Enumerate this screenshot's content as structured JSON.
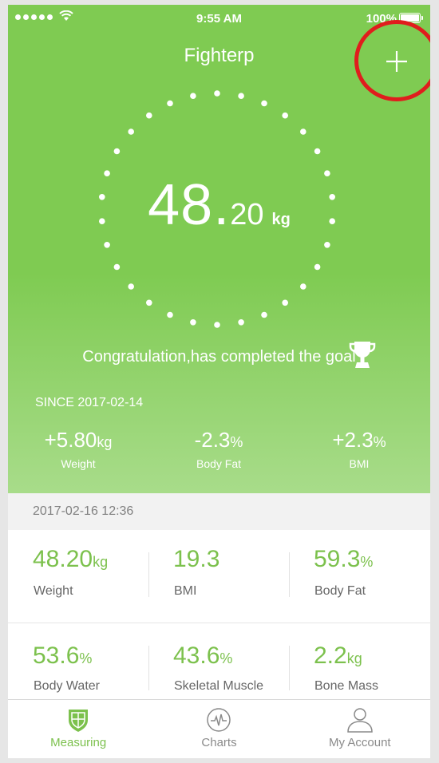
{
  "status_bar": {
    "time": "9:55 AM",
    "battery": "100%"
  },
  "header": {
    "title": "Fighterp"
  },
  "current": {
    "weight_int": "48.",
    "weight_dec": "20",
    "unit": "kg"
  },
  "goal_message": "Congratulation,has completed the goal",
  "since": {
    "label": "SINCE 2017-02-14",
    "changes": [
      {
        "value": "+5.80",
        "unit": "kg",
        "label": "Weight"
      },
      {
        "value": "-2.3",
        "unit": "%",
        "label": "Body Fat"
      },
      {
        "value": "+2.3",
        "unit": "%",
        "label": "BMI"
      }
    ]
  },
  "record": {
    "datetime": "2017-02-16  12:36",
    "metrics": [
      {
        "value": "48.20",
        "unit": "kg",
        "label": "Weight"
      },
      {
        "value": "19.3",
        "unit": "",
        "label": "BMI"
      },
      {
        "value": "59.3",
        "unit": "%",
        "label": "Body Fat"
      },
      {
        "value": "53.6",
        "unit": "%",
        "label": "Body Water"
      },
      {
        "value": "43.6",
        "unit": "%",
        "label": "Skeletal Muscle"
      },
      {
        "value": "2.2",
        "unit": "kg",
        "label": "Bone Mass"
      }
    ]
  },
  "tabs": [
    {
      "label": "Measuring",
      "icon": "shield-icon",
      "active": true
    },
    {
      "label": "Charts",
      "icon": "pulse-chart-icon",
      "active": false
    },
    {
      "label": "My Account",
      "icon": "user-icon",
      "active": false
    }
  ],
  "colors": {
    "accent": "#7cc14d",
    "hero_top": "#7fcb52",
    "hero_bottom": "#a8dc8a",
    "annotation": "#e01d1d"
  }
}
